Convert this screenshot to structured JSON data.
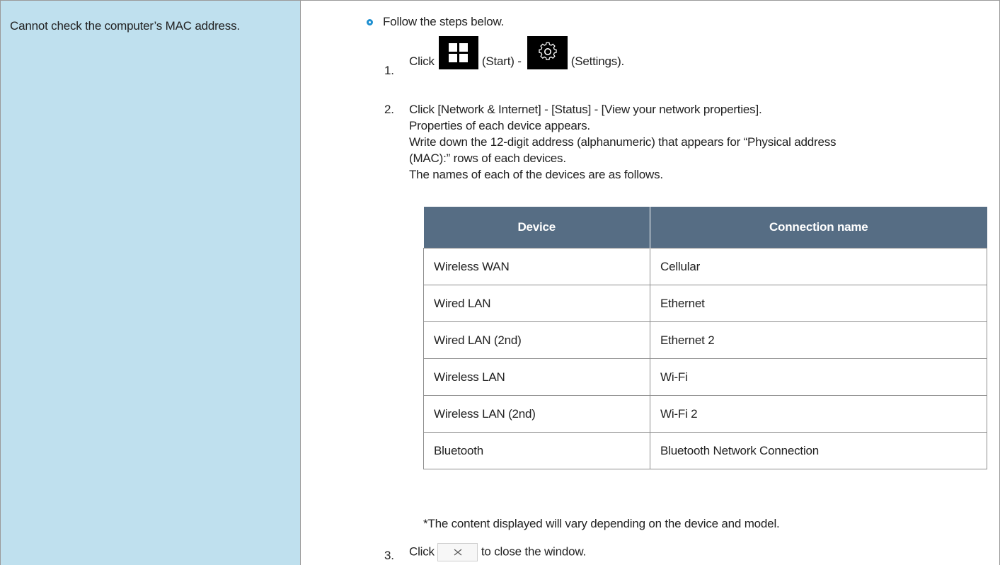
{
  "problem": "Cannot check the computer’s MAC address.",
  "intro": "Follow the steps below.",
  "step1": {
    "num": "1.",
    "click": "Click",
    "start_label": "(Start) -",
    "settings_label": "(Settings)."
  },
  "step2": {
    "num": "2.",
    "lines": [
      "Click [Network & Internet] - [Status] - [View your network properties].",
      "Properties of each device appears.",
      "Write down the 12-digit address (alphanumeric) that appears for “Physical address",
      "(MAC):” rows of each devices.",
      "The names of each of the devices are as follows."
    ]
  },
  "table": {
    "headers": [
      "Device",
      "Connection name"
    ],
    "rows": [
      [
        "Wireless WAN",
        "Cellular"
      ],
      [
        "Wired LAN",
        "Ethernet"
      ],
      [
        "Wired LAN (2nd)",
        "Ethernet 2"
      ],
      [
        "Wireless LAN",
        "Wi-Fi"
      ],
      [
        "Wireless LAN (2nd)",
        "Wi-Fi 2"
      ],
      [
        "Bluetooth",
        "Bluetooth Network Connection"
      ]
    ]
  },
  "note": "*The content displayed will vary depending on the device and model.",
  "step3": {
    "num": "3.",
    "click": "Click",
    "after": "to close the window."
  },
  "colors": {
    "left_bg": "#bfe0ee",
    "header_bg": "#566d84",
    "bullet": "#1e8fd0"
  }
}
